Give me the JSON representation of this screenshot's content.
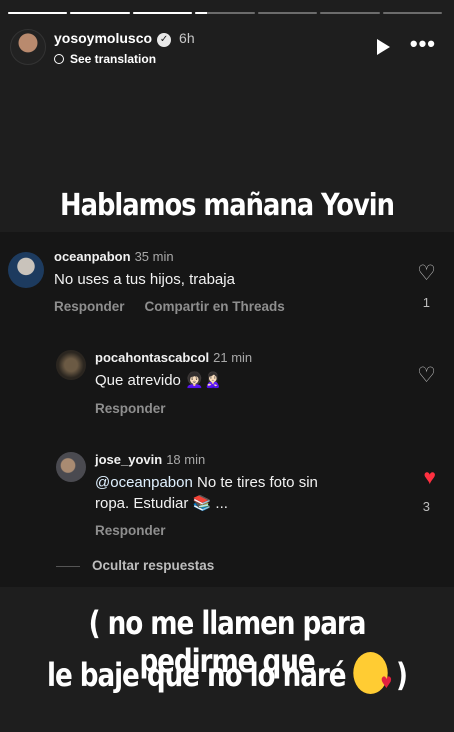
{
  "story": {
    "progress": [
      1,
      1,
      1,
      0.2,
      0,
      0,
      0
    ],
    "username": "yosoymolusco",
    "time": "6h",
    "see_translation": "See translation",
    "title": "Hablamos mañana Yovin",
    "caption_line1": "( no me llamen para pedirme que",
    "caption_line2": "le baje que no lo haré"
  },
  "comments": [
    {
      "user": "oceanpabon",
      "time": "35 min",
      "text": "No uses a tus hijos, trabaja",
      "reply_label": "Responder",
      "share_label": "Compartir en Threads",
      "likes": "1",
      "liked": false
    },
    {
      "user": "pocahontascabcol",
      "time": "21 min",
      "text": "Que atrevido 👩🏻‍🦱🙎🏻‍♀️",
      "reply_label": "Responder",
      "liked": false
    },
    {
      "user": "jose_yovin",
      "time": "18 min",
      "mention": "@oceanpabon",
      "text_line1": " No te tires foto sin",
      "text_line2": "ropa.  Estudiar 📚 ...",
      "reply_label": "Responder",
      "likes": "3",
      "liked": true
    }
  ],
  "hide_replies": "Ocultar respuestas",
  "colors": {
    "like_red": "#ff3040",
    "background": "#1e1e1e",
    "card": "#161616"
  }
}
